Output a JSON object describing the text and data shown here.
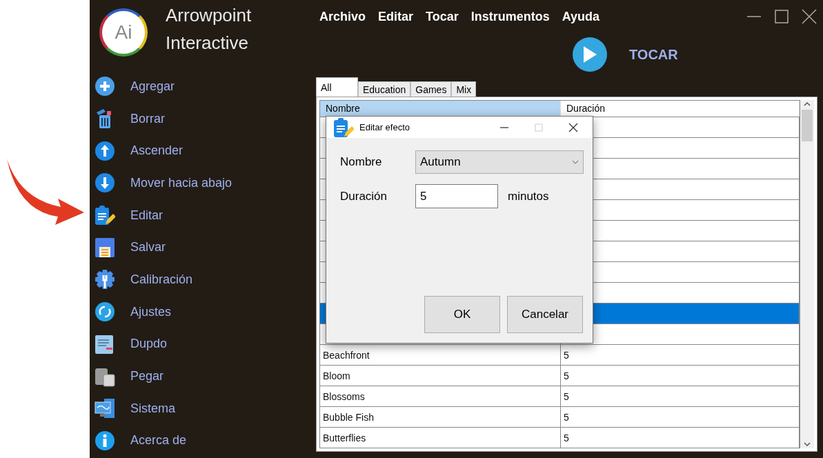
{
  "app": {
    "title_lines": [
      "Arrowpoint",
      "Interactive"
    ],
    "logo_text": "Ai"
  },
  "sidebar": {
    "items": [
      {
        "label": "Agregar",
        "kind": "add"
      },
      {
        "label": "Borrar",
        "kind": "delete"
      },
      {
        "label": "Ascender",
        "kind": "up"
      },
      {
        "label": "Mover hacia abajo",
        "kind": "down"
      },
      {
        "label": "Editar",
        "kind": "edit"
      },
      {
        "label": "Salvar",
        "kind": "save"
      },
      {
        "label": "Calibración",
        "kind": "gear"
      },
      {
        "label": "Ajustes",
        "kind": "sync"
      },
      {
        "label": "Dupdo",
        "kind": "copy"
      },
      {
        "label": "Pegar",
        "kind": "paste"
      },
      {
        "label": "Sistema",
        "kind": "system"
      },
      {
        "label": "Acerca de",
        "kind": "info"
      }
    ]
  },
  "menu": [
    "Archivo",
    "Editar",
    "Tocar",
    "Instrumentos",
    "Ayuda"
  ],
  "play": {
    "label": "TOCAR"
  },
  "tabs": [
    {
      "label": "All",
      "selected": true
    },
    {
      "label": "Education",
      "selected": false
    },
    {
      "label": "Games",
      "selected": false
    },
    {
      "label": "Mix",
      "selected": false
    }
  ],
  "table": {
    "columns": [
      {
        "label": "Nombre",
        "selected": true
      },
      {
        "label": "Duración",
        "selected": false
      }
    ],
    "rows": [
      {
        "selected": false
      },
      {
        "selected": false
      },
      {
        "selected": false
      },
      {
        "selected": false
      },
      {
        "selected": false
      },
      {
        "selected": false
      },
      {
        "selected": false
      },
      {
        "selected": false
      },
      {
        "selected": false
      },
      {
        "selected": true
      },
      {
        "selected": false
      },
      {
        "name": "Beachfront",
        "duration": "5",
        "selected": false
      },
      {
        "name": "Bloom",
        "duration": "5",
        "selected": false
      },
      {
        "name": "Blossoms",
        "duration": "5",
        "selected": false
      },
      {
        "name": "Bubble Fish",
        "duration": "5",
        "selected": false
      },
      {
        "name": "Butterflies",
        "duration": "5",
        "selected": false
      }
    ]
  },
  "dialog": {
    "title": "Editar efecto",
    "fields": [
      {
        "label": "Nombre",
        "kind": "dropdown",
        "value": "Autumn"
      },
      {
        "label": "Duración",
        "kind": "text",
        "value": "5",
        "unit": "minutos"
      }
    ],
    "buttons": [
      "OK",
      "Cancelar"
    ]
  }
}
